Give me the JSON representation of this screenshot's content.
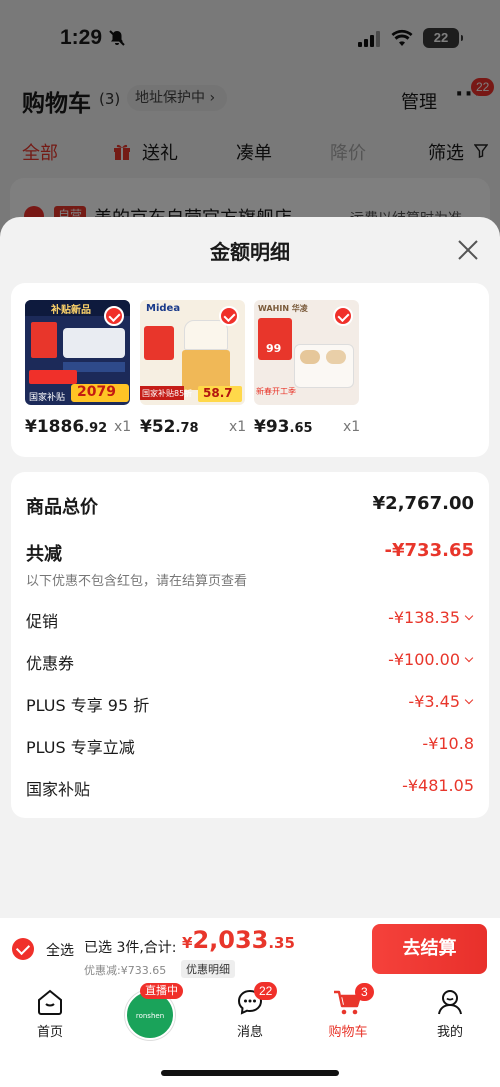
{
  "status_bar": {
    "time": "1:29",
    "battery": "22"
  },
  "cart_header": {
    "title": "购物车",
    "count": "(3)",
    "address_label": "地址保护中 ›",
    "manage_label": "管理",
    "more_label": "···",
    "more_badge": "22"
  },
  "filter_tabs": [
    {
      "label": "全部"
    },
    {
      "label": "送礼"
    },
    {
      "label": "凑单"
    },
    {
      "label": "降价"
    },
    {
      "label": "筛选"
    }
  ],
  "store_bar": {
    "tag": "自营",
    "name": "美的京东自营官方旗舰店",
    "shipping_note": "运费以结算时为准"
  },
  "sheet": {
    "title": "金额明细",
    "products": [
      {
        "price_int": "¥1886",
        "price_dec": ".92",
        "qty": "x1",
        "img_top": "补贴新品",
        "img_price": "2079",
        "img_accent": "#d6231b",
        "img_sub": "国家补贴"
      },
      {
        "price_int": "¥52",
        "price_dec": ".78",
        "qty": "x1",
        "img_top": "Midea",
        "img_price": "58.7",
        "img_accent": "#c51d18",
        "img_sub": "国家补贴85折"
      },
      {
        "price_int": "¥93",
        "price_dec": ".65",
        "qty": "x1",
        "img_top": "WAHIN 华凌",
        "img_price": "99",
        "img_accent": "#e8362b",
        "img_sub": "新春开工季"
      }
    ],
    "summary": {
      "total_label": "商品总价",
      "total_value": "¥2,767.00",
      "discount_label": "共减",
      "discount_value": "-¥733.65",
      "discount_note": "以下优惠不包含红包，请在结算页查看",
      "items": [
        {
          "label": "促销",
          "value": "-¥138.35",
          "expandable": true
        },
        {
          "label": "优惠券",
          "value": "-¥100.00",
          "expandable": true
        },
        {
          "label": "PLUS 专享 95 折",
          "value": "-¥3.45",
          "expandable": true
        },
        {
          "label": "PLUS 专享立减",
          "value": "-¥10.8",
          "expandable": false
        },
        {
          "label": "国家补贴",
          "value": "-¥481.05",
          "expandable": false
        }
      ]
    }
  },
  "bottom_bar": {
    "select_all": "全选",
    "selected_text": "已选 3件,合计:",
    "total_symbol": "¥",
    "total_int": "2,033",
    "total_dec": ".35",
    "discount_text": "优惠减:¥733.65",
    "detail_label": "优惠明细",
    "checkout_label": "去结算"
  },
  "tab_bar": {
    "live_badge": "直播中",
    "live_text": "ronshen",
    "message_badge": "22",
    "cart_badge": "3",
    "tabs": [
      {
        "label": "首页",
        "active": false
      },
      {
        "label": "消息",
        "active": false
      },
      {
        "label": "购物车",
        "active": true
      },
      {
        "label": "我的",
        "active": false
      }
    ]
  },
  "colors": {
    "accent": "#e8362b",
    "brand_red": "#f0302a",
    "live_green": "#1aa35a"
  }
}
